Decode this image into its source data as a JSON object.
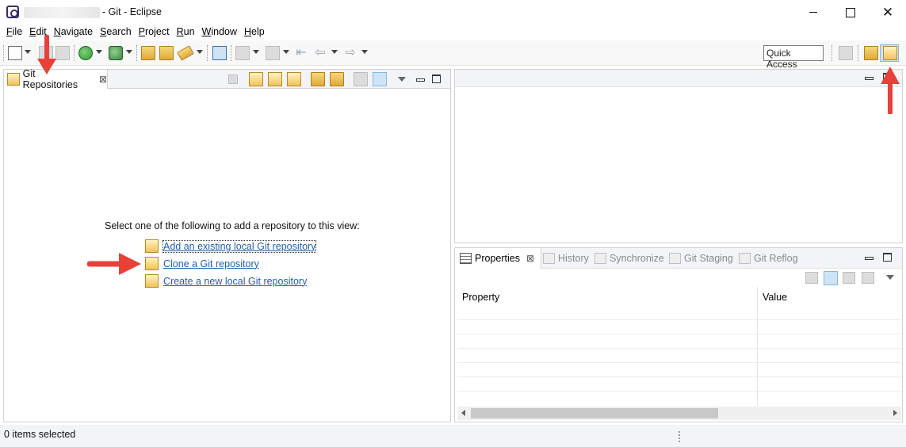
{
  "window": {
    "title_suffix": "- Git - Eclipse",
    "minimize_label": "",
    "maximize_label": "",
    "close_label": "✕"
  },
  "menu": [
    {
      "label": "File",
      "mnemonic": "F",
      "rest": "ile"
    },
    {
      "label": "Edit",
      "mnemonic": "E",
      "rest": "dit"
    },
    {
      "label": "Navigate",
      "mnemonic": "N",
      "rest": "avigate"
    },
    {
      "label": "Search",
      "mnemonic": "S",
      "rest": "earch"
    },
    {
      "label": "Project",
      "mnemonic": "P",
      "rest": "roject"
    },
    {
      "label": "Run",
      "mnemonic": "R",
      "rest": "un"
    },
    {
      "label": "Window",
      "mnemonic": "W",
      "rest": "indow"
    },
    {
      "label": "Help",
      "mnemonic": "H",
      "rest": "elp"
    }
  ],
  "toolbar": {
    "quick_access": "Quick Access"
  },
  "git_view": {
    "tab_label": "Git Repositories",
    "tab_close": "⊠",
    "prompt": "Select one of the following to add a repository to this view:",
    "links": [
      {
        "label": "Add an existing local Git repository"
      },
      {
        "label": "Clone a Git repository"
      },
      {
        "label": "Create a new local Git repository"
      }
    ]
  },
  "properties_view": {
    "tabs": [
      {
        "label": "Properties",
        "active": true
      },
      {
        "label": "History",
        "active": false
      },
      {
        "label": "Synchronize",
        "active": false
      },
      {
        "label": "Git Staging",
        "active": false
      },
      {
        "label": "Git Reflog",
        "active": false
      }
    ],
    "tab_close": "⊠",
    "columns": [
      "Property",
      "Value"
    ]
  },
  "status": {
    "text": "0 items selected"
  },
  "colors": {
    "link": "#1f5fb0",
    "annotation_arrow": "#e8413a",
    "selected_button": "#cde4f7"
  }
}
